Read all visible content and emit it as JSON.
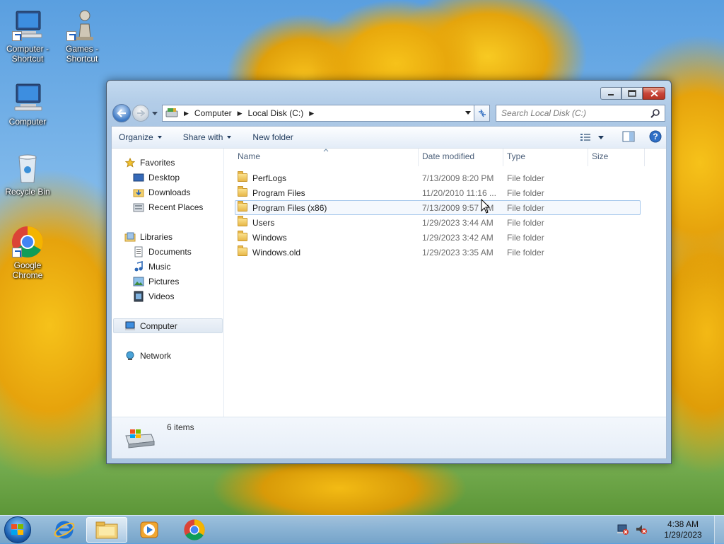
{
  "desktop": {
    "icons": [
      {
        "label_line1": "Computer -",
        "label_line2": "Shortcut",
        "icon": "computer-shortcut-icon"
      },
      {
        "label_line1": "Games -",
        "label_line2": "Shortcut",
        "icon": "games-shortcut-icon"
      },
      {
        "label_line1": "Computer",
        "label_line2": "",
        "icon": "computer-icon"
      },
      {
        "label_line1": "Recycle Bin",
        "label_line2": "",
        "icon": "recycle-bin-icon"
      },
      {
        "label_line1": "Google",
        "label_line2": "Chrome",
        "icon": "chrome-icon"
      }
    ]
  },
  "window": {
    "address": [
      "Computer",
      "Local Disk (C:)"
    ],
    "search_placeholder": "Search Local Disk (C:)",
    "toolbar": {
      "organize": "Organize",
      "share_with": "Share with",
      "new_folder": "New folder"
    },
    "nav": {
      "favorites": "Favorites",
      "desktop": "Desktop",
      "downloads": "Downloads",
      "recent_places": "Recent Places",
      "libraries": "Libraries",
      "documents": "Documents",
      "music": "Music",
      "pictures": "Pictures",
      "videos": "Videos",
      "computer": "Computer",
      "network": "Network"
    },
    "columns": {
      "name": "Name",
      "date_modified": "Date modified",
      "type": "Type",
      "size": "Size"
    },
    "files": [
      {
        "name": "PerfLogs",
        "date": "7/13/2009 8:20 PM",
        "type": "File folder"
      },
      {
        "name": "Program Files",
        "date": "11/20/2010 11:16 ...",
        "type": "File folder"
      },
      {
        "name": "Program Files (x86)",
        "date": "7/13/2009 9:57 PM",
        "type": "File folder"
      },
      {
        "name": "Users",
        "date": "1/29/2023 3:44 AM",
        "type": "File folder"
      },
      {
        "name": "Windows",
        "date": "1/29/2023 3:42 AM",
        "type": "File folder"
      },
      {
        "name": "Windows.old",
        "date": "1/29/2023 3:35 AM",
        "type": "File folder"
      }
    ],
    "details": {
      "item_count": "6 items"
    }
  },
  "taskbar": {
    "time": "4:38 AM",
    "date": "1/29/2023"
  }
}
